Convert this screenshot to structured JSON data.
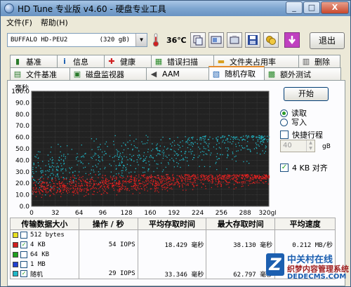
{
  "window": {
    "title": "HD Tune 专业版 v4.60 - 硬盘专业工具",
    "minimize": "_",
    "maximize": "□",
    "close": "X"
  },
  "menu": {
    "file": "文件(F)",
    "help": "帮助(H)"
  },
  "toolbar": {
    "drive": "BUFFALO HD-PEU2",
    "drive_size": "(320 gB)",
    "temperature": "36℃",
    "exit": "退出"
  },
  "tabs_row1": [
    {
      "label": "基准",
      "icon": "benchmark-icon",
      "color": "#2a7a2a",
      "glyph": "▮"
    },
    {
      "label": "信息",
      "icon": "info-icon",
      "color": "#1c5fb0",
      "glyph": "i"
    },
    {
      "label": "健康",
      "icon": "health-plus-icon",
      "color": "#d02020",
      "glyph": "✚"
    },
    {
      "label": "错误扫描",
      "icon": "error-scan-icon",
      "color": "#2a8a2a",
      "glyph": "▦"
    },
    {
      "label": "文件夹占用率",
      "icon": "folder-icon",
      "color": "#d8a020",
      "glyph": "▬"
    },
    {
      "label": "删除",
      "icon": "trash-icon",
      "color": "#555555",
      "glyph": "▥"
    }
  ],
  "tabs_row2": [
    {
      "label": "文件基准",
      "icon": "file-benchmark-icon",
      "color": "#2a7a2a",
      "glyph": "▤"
    },
    {
      "label": "磁盘监视器",
      "icon": "disk-monitor-icon",
      "color": "#2a7a2a",
      "glyph": "▣"
    },
    {
      "label": "AAM",
      "icon": "speaker-icon",
      "color": "#444444",
      "glyph": "◀"
    },
    {
      "label": "随机存取",
      "icon": "random-access-icon",
      "color": "#1c5fb0",
      "glyph": "▧",
      "active": true
    },
    {
      "label": "额外测试",
      "icon": "extra-tests-icon",
      "color": "#2a8a2a",
      "glyph": "▩"
    }
  ],
  "chart": {
    "unit": "毫秒"
  },
  "chart_data": {
    "type": "scatter",
    "ylabel": "毫秒",
    "ylim": [
      0,
      100
    ],
    "y_ticks": [
      "100.0",
      "90.0",
      "80.0",
      "70.0",
      "60.0",
      "50.0",
      "40.0",
      "30.0",
      "20.0",
      "10.0",
      "0.0"
    ],
    "x_ticks": [
      "0",
      "32",
      "64",
      "96",
      "128",
      "160",
      "192",
      "224",
      "256",
      "288",
      "320gB"
    ],
    "xlim": [
      0,
      320
    ],
    "grid": true,
    "series": [
      {
        "name": "4 KB",
        "color": "#e02020",
        "y_band": [
          4,
          28
        ],
        "y_center": 16,
        "trend_per_gb": 0.015,
        "count": 1200
      },
      {
        "name": "随机",
        "color": "#20b8c8",
        "y_band": [
          10,
          62
        ],
        "y_center": 30,
        "trend_per_gb": 0.018,
        "count": 700
      }
    ]
  },
  "controls": {
    "start": "开始",
    "read": "读取",
    "write": "写入",
    "short_stroke": "快捷行程",
    "short_stroke_value": "40",
    "short_stroke_unit": "gB",
    "align_4kb": "4 KB 对齐"
  },
  "results": {
    "headers": [
      "传输数据大小",
      "操作 / 秒",
      "平均存取时间",
      "最大存取时间",
      "平均速度"
    ],
    "rows": [
      {
        "label": "512 bytes",
        "checked": false,
        "color": "#e8e020",
        "ops": "",
        "avg": "",
        "max": "",
        "speed": ""
      },
      {
        "label": "4 KB",
        "checked": true,
        "color": "#d02020",
        "ops": "54 IOPS",
        "avg": "18.429 毫秒",
        "max": "38.130 毫秒",
        "speed": "0.212 MB/秒"
      },
      {
        "label": "64 KB",
        "checked": false,
        "color": "#20a020",
        "ops": "",
        "avg": "",
        "max": "",
        "speed": ""
      },
      {
        "label": "1 MB",
        "checked": false,
        "color": "#2040d0",
        "ops": "",
        "avg": "",
        "max": "",
        "speed": ""
      },
      {
        "label": "随机",
        "checked": true,
        "color": "#20b8c8",
        "ops": "29 IOPS",
        "avg": "33.346 毫秒",
        "max": "62.797 毫秒",
        "speed": ""
      }
    ]
  },
  "watermark": {
    "line1": "中关村在线",
    "line2": "织梦内容管理系统",
    "line3": "DEDECMS.COM"
  }
}
